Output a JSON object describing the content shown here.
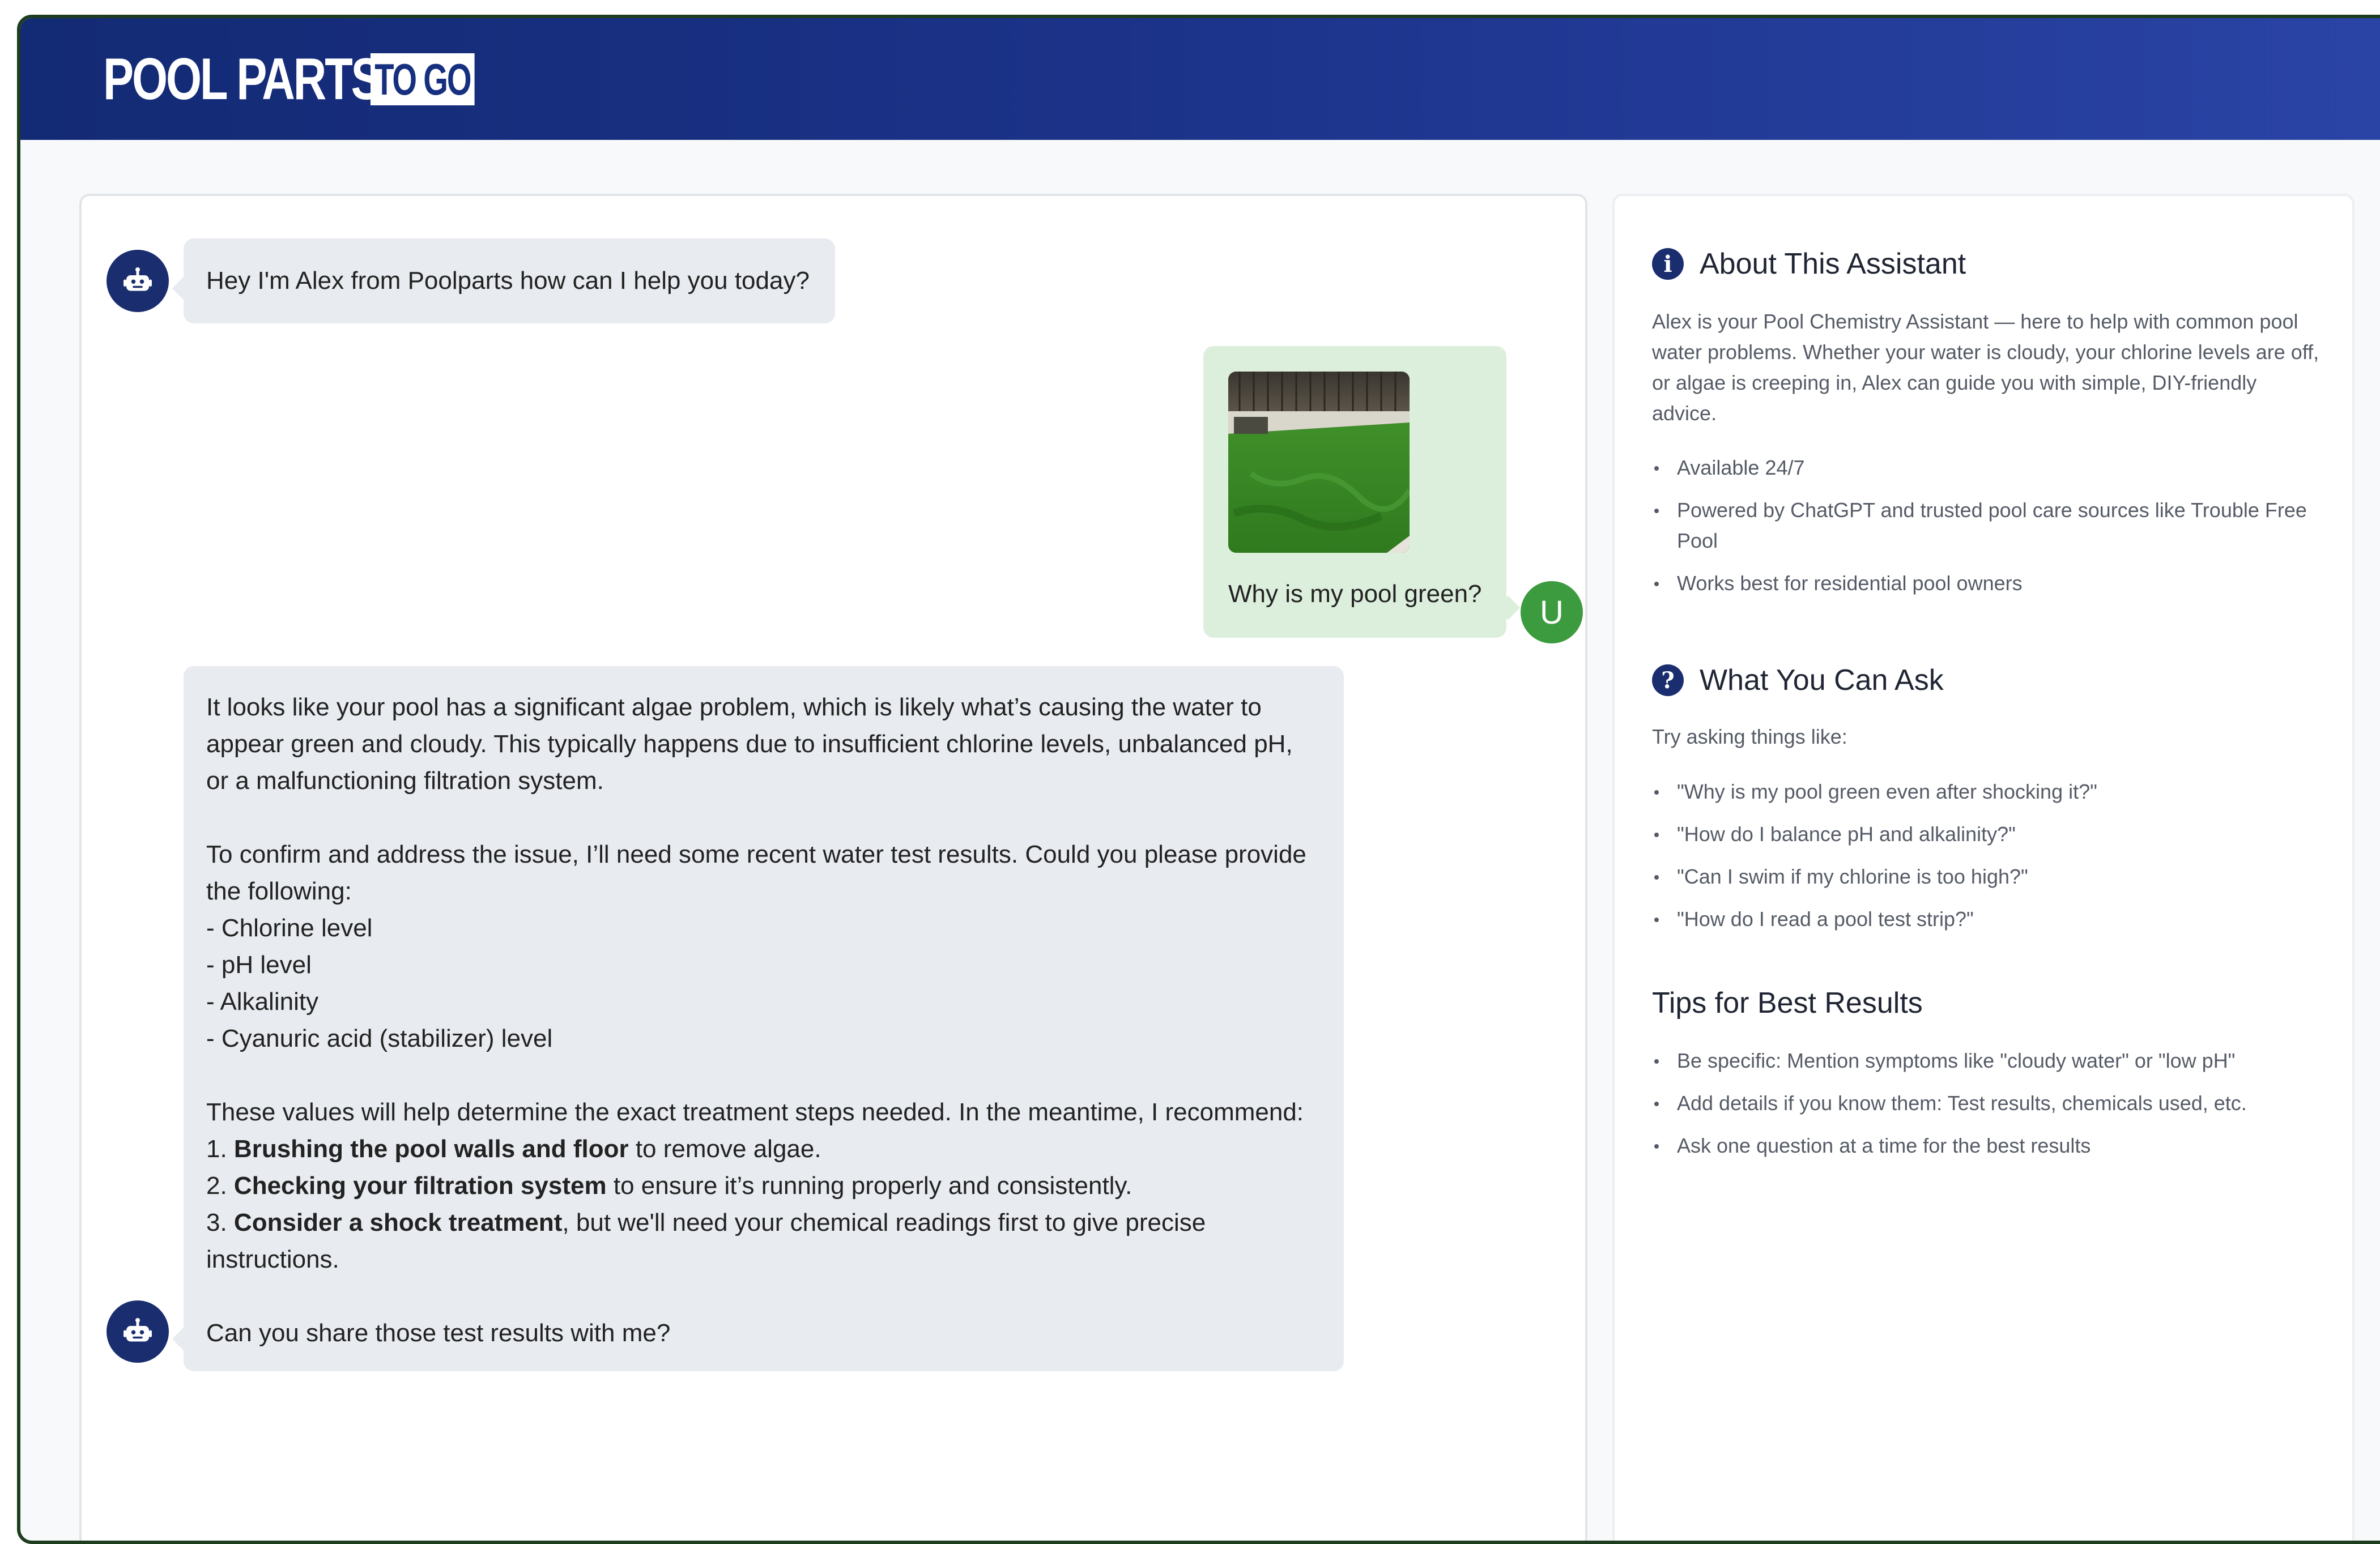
{
  "brand": {
    "name": "POOL PARTS",
    "tag": "TO GO"
  },
  "chat": {
    "greeting": "Hey I'm Alex from Poolparts how can I help you today?",
    "user_message": "Why is my pool green?",
    "user_avatar_letter": "U",
    "reply": {
      "p1": "It looks like your pool has a significant algae problem, which is likely what’s causing the water to appear green and cloudy. This typically happens due to insufficient chlorine levels, unbalanced pH, or a malfunctioning filtration system.",
      "p2_intro": "To confirm and address the issue, I’ll need some recent water test results. Could you please provide the following:",
      "p2_items": [
        "- Chlorine level",
        "- pH level",
        "- Alkalinity",
        "- Cyanuric acid (stabilizer) level"
      ],
      "p3_intro": "These values will help determine the exact treatment steps needed. In the meantime, I recommend:",
      "steps": [
        {
          "num": "1. ",
          "bold": "Brushing the pool walls and floor",
          "rest": " to remove algae."
        },
        {
          "num": "2. ",
          "bold": "Checking your filtration system",
          "rest": " to ensure it’s running properly and consistently."
        },
        {
          "num": "3. ",
          "bold": "Consider a shock treatment",
          "rest": ", but we'll need your chemical readings first to give precise instructions."
        }
      ],
      "closing": "Can you share those test results with me?"
    }
  },
  "sidebar": {
    "about": {
      "title": "About This Assistant",
      "icon": "info-icon",
      "text": "Alex is your Pool Chemistry Assistant — here to help with common pool water problems. Whether your water is cloudy, your chlorine levels are off, or algae is creeping in, Alex can guide you with simple, DIY-friendly advice.",
      "items": [
        "Available 24/7",
        "Powered by ChatGPT and trusted pool care sources like Trouble Free Pool",
        "Works best for residential pool owners"
      ]
    },
    "ask": {
      "title": "What You Can Ask",
      "icon": "question-icon",
      "text": "Try asking things like:",
      "items": [
        "\"Why is my pool green even after shocking it?\"",
        "\"How do I balance pH and alkalinity?\"",
        "\"Can I swim if my chlorine is too high?\"",
        "\"How do I read a pool test strip?\""
      ]
    },
    "tips": {
      "title": "Tips for Best Results",
      "items": [
        "Be specific: Mention symptoms like \"cloudy water\" or \"low pH\"",
        "Add details if you know them: Test results, chemicals used, etc.",
        "Ask one question at a time for the best results"
      ]
    }
  },
  "colors": {
    "header": "#1b3288",
    "bot_avatar": "#1a2d6e",
    "user_avatar": "#3d9b3f",
    "bot_bubble": "#e8ebf0",
    "user_bubble": "#dcefdc"
  }
}
